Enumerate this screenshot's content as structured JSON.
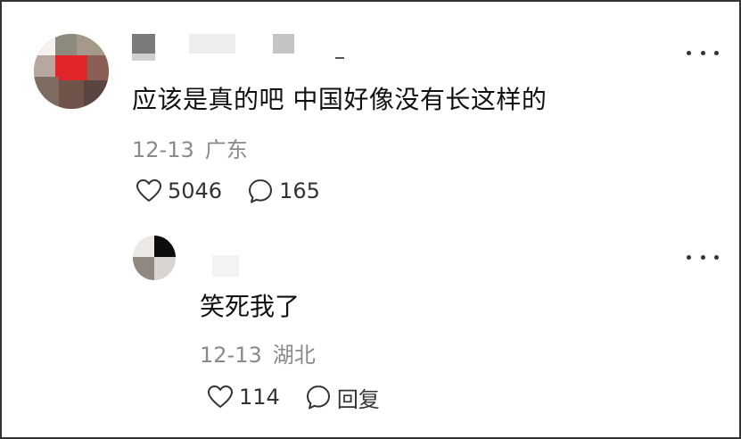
{
  "comment": {
    "text": "应该是真的吧 中国好像没有长这样的",
    "date": "12-13",
    "location": "广东",
    "likes": "5046",
    "replies": "165",
    "icons": {
      "like": "heart-icon",
      "reply": "comment-bubble-icon",
      "more": "more-dots-icon"
    }
  },
  "reply": {
    "text": "笑死我了",
    "date": "12-13",
    "location": "湖北",
    "likes": "114",
    "reply_label": "回复",
    "icons": {
      "like": "heart-icon",
      "reply": "comment-bubble-icon",
      "more": "more-dots-icon"
    }
  },
  "colors": {
    "text": "#111111",
    "meta": "#8a8a8a",
    "icon": "#333333"
  }
}
